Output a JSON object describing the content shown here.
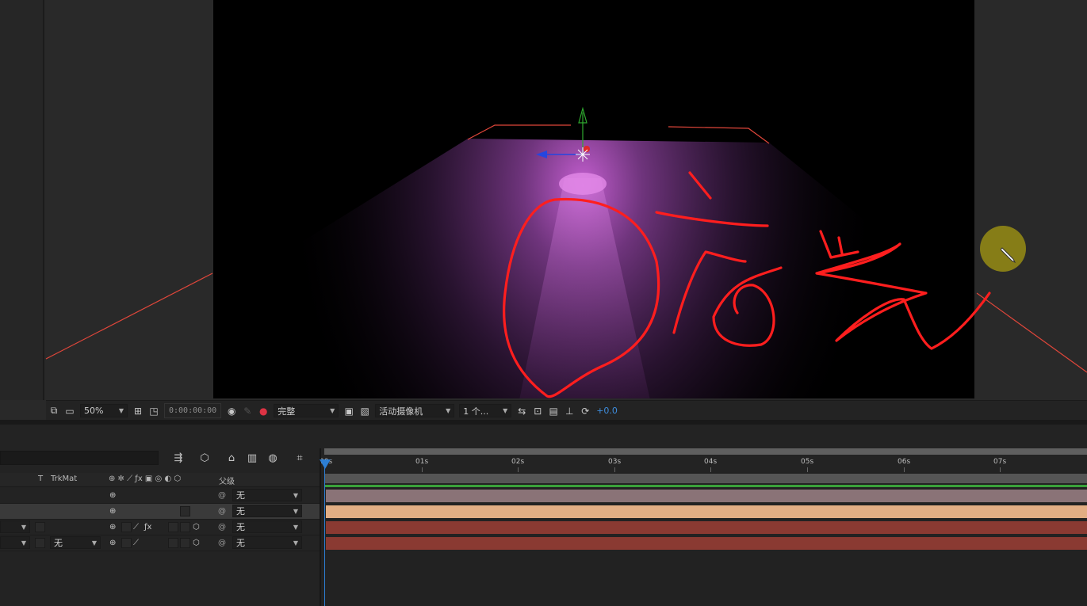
{
  "viewer": {
    "zoom": "50%",
    "timecode": "0:00:00:00",
    "resolution": "完整",
    "camera": "活动摄像机",
    "views": "1 个...",
    "exposure": "+0.0"
  },
  "annotation": {
    "handwritten_text": "启光",
    "color": "#ff1e1e"
  },
  "timeline": {
    "tools": [
      "compositing-flowchart-icon",
      "draft-3d-icon",
      "shy-layers-icon",
      "frame-blending-icon",
      "motion-blur-icon",
      "graph-editor-icon"
    ],
    "columns": {
      "t": "T",
      "trkmat": "TrkMat",
      "parent": "父级"
    },
    "ruler": [
      "00s",
      "01s",
      "02s",
      "03s",
      "04s",
      "05s",
      "06s",
      "07s"
    ],
    "layers": [
      {
        "parent": "无",
        "trkmat": "",
        "color": "#8a7377"
      },
      {
        "parent": "无",
        "trkmat": "",
        "color": "#e2ae84"
      },
      {
        "parent": "无",
        "trkmat": "",
        "color": "#8a3a32"
      },
      {
        "parent": "无",
        "trkmat": "无",
        "color": "#8a3a32"
      }
    ]
  }
}
